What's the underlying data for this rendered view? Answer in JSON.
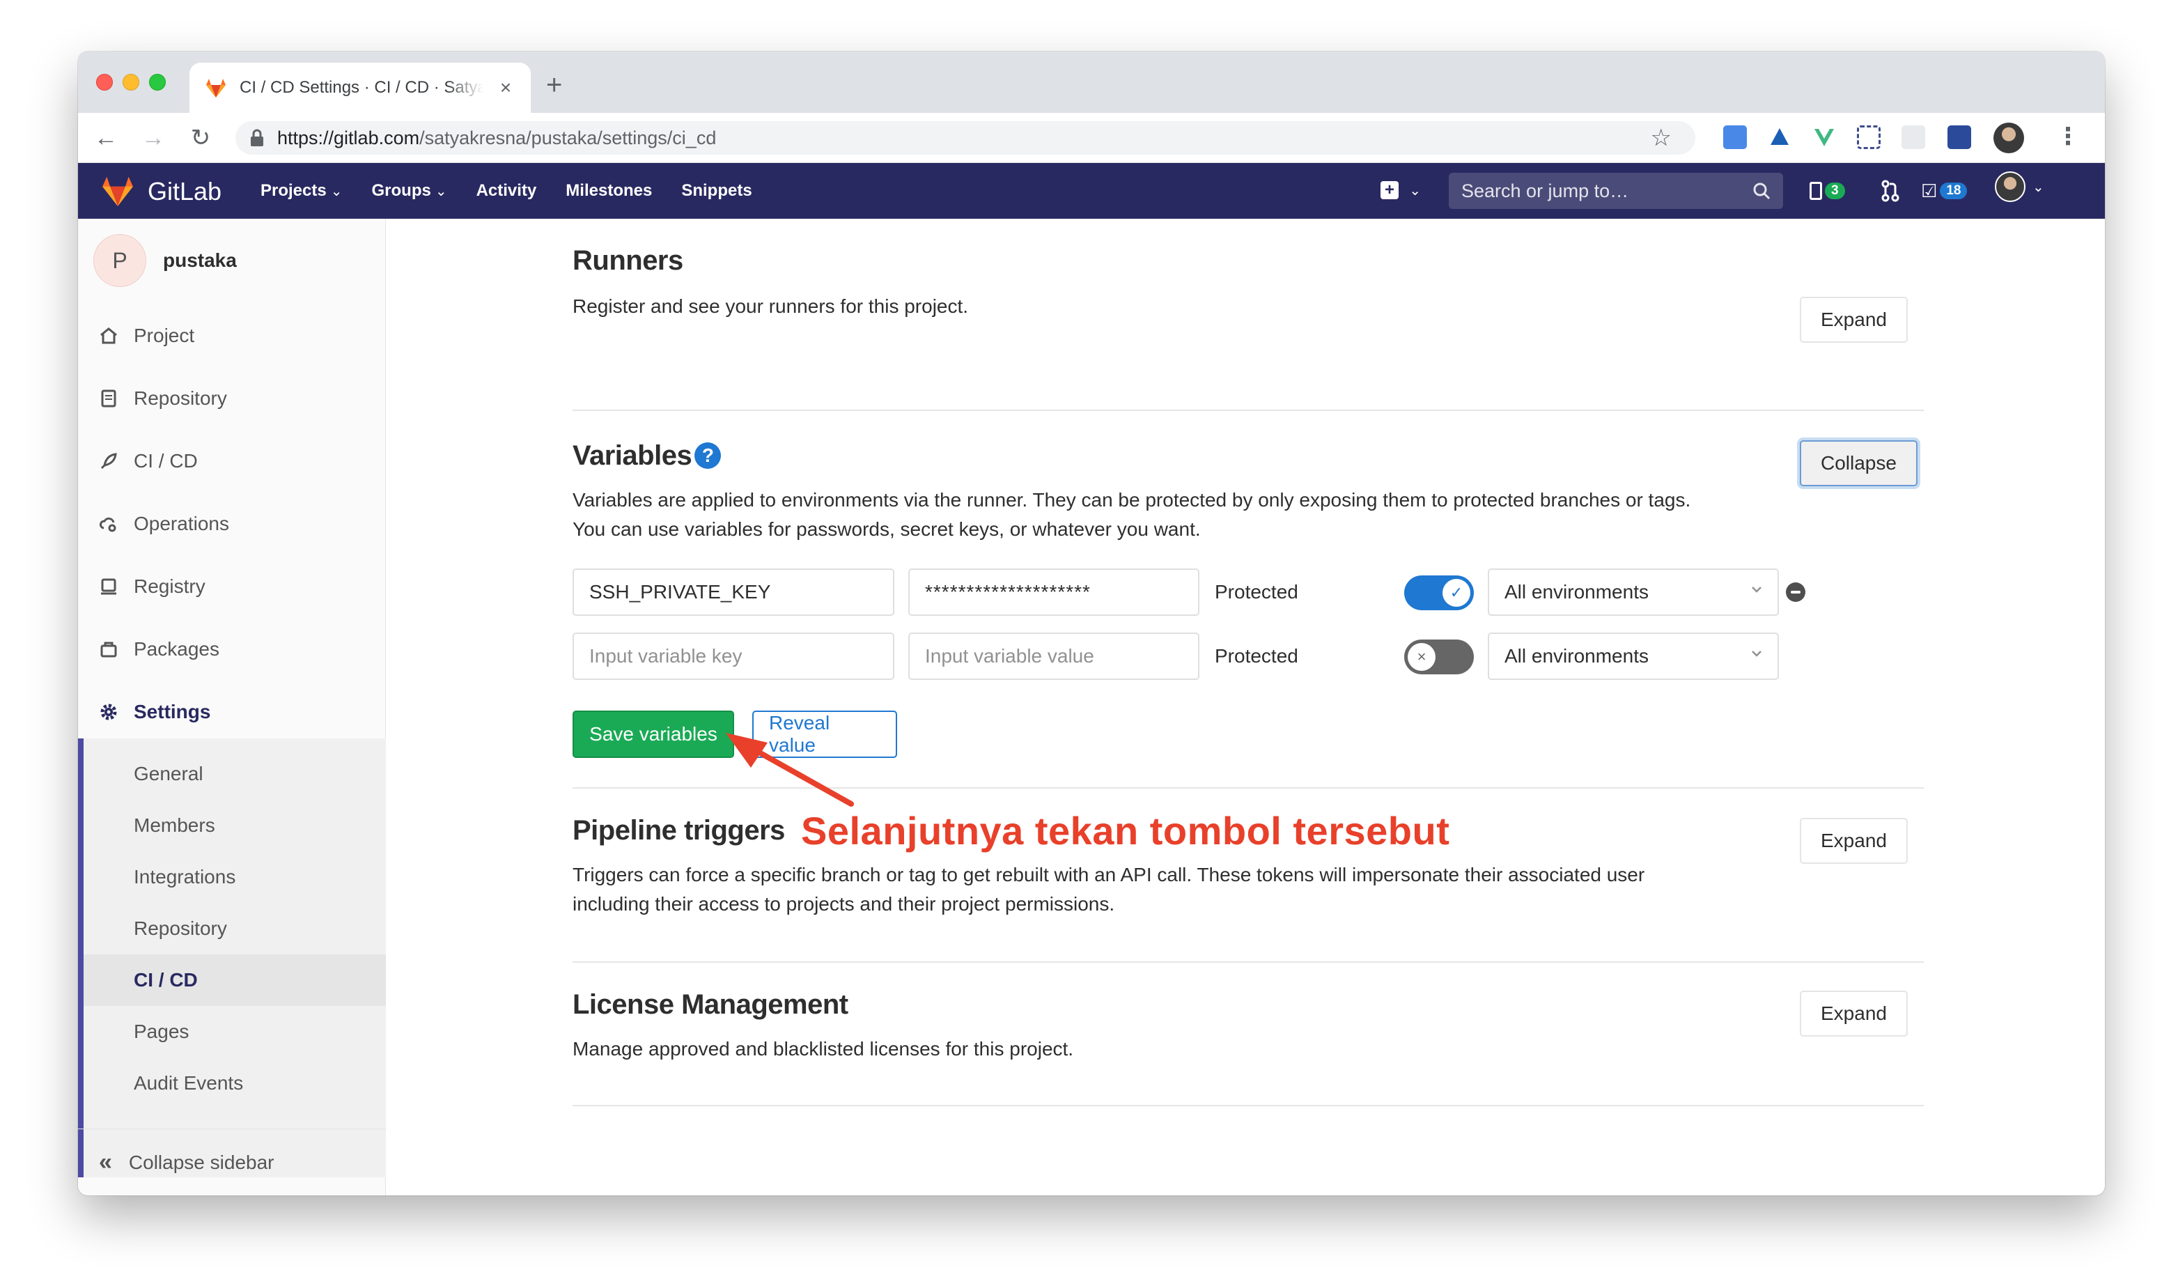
{
  "browser": {
    "tab_title": "CI / CD Settings · CI / CD · Satyakresna / pustaka · GitLab",
    "new_tab_symbol": "+",
    "url_host": "https://gitlab.com",
    "url_path": "/satyakresna/pustaka/settings/ci_cd"
  },
  "gitlab_header": {
    "brand": "GitLab",
    "nav": [
      "Projects",
      "Groups",
      "Activity",
      "Milestones",
      "Snippets"
    ],
    "search_placeholder": "Search or jump to…",
    "issues_count": "3",
    "todos_count": "18"
  },
  "sidebar": {
    "project_initial": "P",
    "project_name": "pustaka",
    "items": [
      {
        "label": "Project",
        "icon": "home-icon"
      },
      {
        "label": "Repository",
        "icon": "doc-icon"
      },
      {
        "label": "CI / CD",
        "icon": "rocket-icon"
      },
      {
        "label": "Operations",
        "icon": "cloud-gear-icon"
      },
      {
        "label": "Registry",
        "icon": "disk-icon"
      },
      {
        "label": "Packages",
        "icon": "package-icon"
      }
    ],
    "settings_label": "Settings",
    "settings_sub": [
      "General",
      "Members",
      "Integrations",
      "Repository",
      "CI / CD",
      "Pages",
      "Audit Events"
    ],
    "active_sub": "CI / CD",
    "collapse_label": "Collapse sidebar"
  },
  "main": {
    "runners": {
      "title": "Runners",
      "description": "Register and see your runners for this project.",
      "button": "Expand"
    },
    "variables": {
      "title": "Variables",
      "description_1": "Variables are applied to environments via the runner. They can be protected by only exposing them to protected branches or tags.",
      "description_2": "You can use variables for passwords, secret keys, or whatever you want.",
      "button": "Collapse",
      "rows": [
        {
          "key": "SSH_PRIVATE_KEY",
          "value": "********************",
          "protected_label": "Protected",
          "protected": true,
          "environment": "All environments"
        },
        {
          "key_placeholder": "Input variable key",
          "value_placeholder": "Input variable value",
          "protected_label": "Protected",
          "protected": false,
          "environment": "All environments"
        }
      ],
      "save_button": "Save variables",
      "reveal_button": "Reveal value"
    },
    "pipeline_triggers": {
      "title": "Pipeline triggers",
      "description_1": "Triggers can force a specific branch or tag to get rebuilt with an API call. These tokens will impersonate their associated user",
      "description_2": "including their access to projects and their project permissions.",
      "button": "Expand"
    },
    "license_management": {
      "title": "License Management",
      "description": "Manage approved and blacklisted licenses for this project.",
      "button": "Expand"
    }
  },
  "annotation": {
    "text": "Selanjutnya tekan tombol tersebut",
    "color": "#e8402a"
  },
  "colors": {
    "header_bg": "#292961",
    "accent_blue": "#1f78d1",
    "success_green": "#1aaa55"
  }
}
